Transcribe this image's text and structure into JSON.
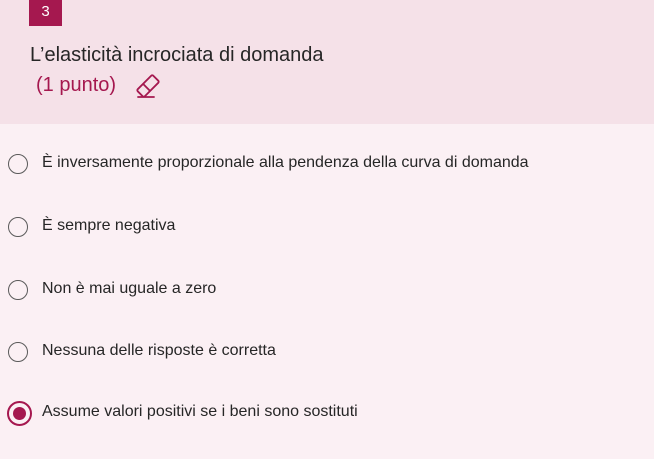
{
  "question": {
    "number": "3",
    "title": "L’elasticità incrociata di domanda",
    "points": "(1 punto)",
    "accent_color": "#a5184f"
  },
  "options": [
    {
      "label": "È inversamente proporzionale alla pendenza della curva di domanda",
      "selected": false
    },
    {
      "label": "È sempre negativa",
      "selected": false
    },
    {
      "label": "Non è mai uguale a zero",
      "selected": false
    },
    {
      "label": "Nessuna delle risposte è corretta",
      "selected": false
    },
    {
      "label": "Assume valori positivi se i beni sono sostituti",
      "selected": true
    }
  ],
  "icons": {
    "clear_response": "eraser-icon"
  }
}
